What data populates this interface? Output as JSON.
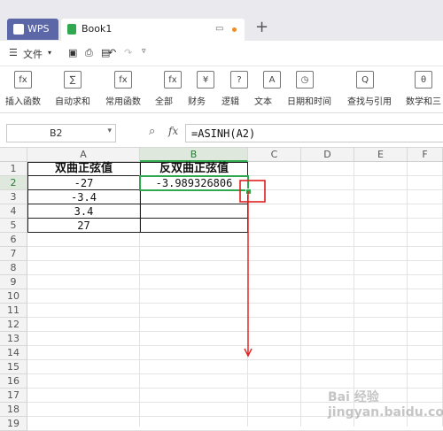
{
  "tabs": {
    "wps": "WPS",
    "book": "Book1"
  },
  "menu": {
    "file": "文件"
  },
  "ribbon": [
    {
      "icon": "fx-icon",
      "label": "插入函数",
      "glyph": "fx"
    },
    {
      "icon": "sigma-icon",
      "label": "自动求和",
      "glyph": "∑"
    },
    {
      "icon": "star-function-icon",
      "label": "常用函数",
      "glyph": "fx"
    },
    {
      "icon": "all-functions-icon",
      "label": "全部",
      "glyph": "fx"
    },
    {
      "icon": "finance-icon",
      "label": "财务",
      "glyph": "¥"
    },
    {
      "icon": "logic-icon",
      "label": "逻辑",
      "glyph": "?"
    },
    {
      "icon": "text-icon",
      "label": "文本",
      "glyph": "A"
    },
    {
      "icon": "datetime-icon",
      "label": "日期和时间",
      "glyph": "◷"
    },
    {
      "icon": "lookup-icon",
      "label": "查找与引用",
      "glyph": "Q"
    },
    {
      "icon": "math-icon",
      "label": "数学和三",
      "glyph": "θ"
    }
  ],
  "namebox": "B2",
  "fx_label": "fx",
  "formula": "=ASINH(A2)",
  "columns": [
    "A",
    "B",
    "C",
    "D",
    "E",
    "F"
  ],
  "rows": [
    "1",
    "2",
    "3",
    "4",
    "5",
    "6",
    "7",
    "8",
    "9",
    "10",
    "11",
    "12",
    "13",
    "14",
    "15",
    "16",
    "17",
    "18",
    "19"
  ],
  "cells": {
    "A1": "双曲正弦值",
    "B1": "反双曲正弦值",
    "A2": "-27",
    "B2": "-3.989326806",
    "A3": "-3.4",
    "A4": "3.4",
    "A5": "27"
  },
  "watermark": "Bai 经验 jingyan.baidu.com",
  "colors": {
    "accent_green": "#2fa84f",
    "annotation_red": "#e02020",
    "wps_tab": "#5b67a7"
  }
}
